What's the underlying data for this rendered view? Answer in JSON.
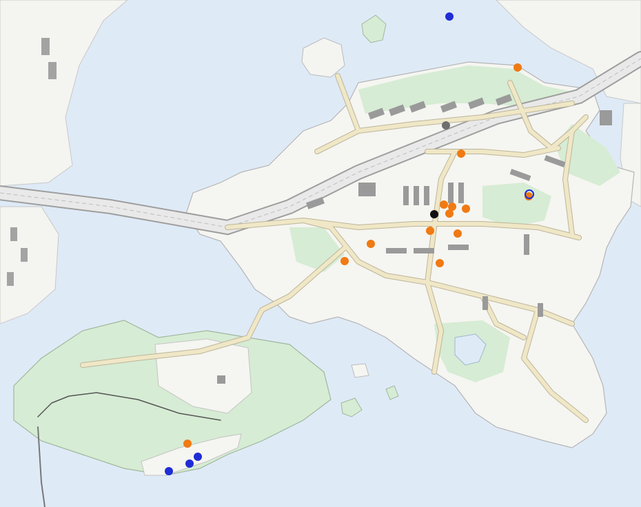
{
  "map": {
    "colors": {
      "water": "#dfeaf7",
      "land": "#f5f5f1",
      "park": "#d6ecd4",
      "road": "#efe7c6",
      "road_casing": "#bdb59a",
      "building": "#9a9a9a",
      "motorway": "#e6e6e6"
    },
    "markers": {
      "orange": "#f07a13",
      "blue": "#1f2dd6",
      "black": "#111111",
      "grey": "#6f6f6f"
    }
  }
}
